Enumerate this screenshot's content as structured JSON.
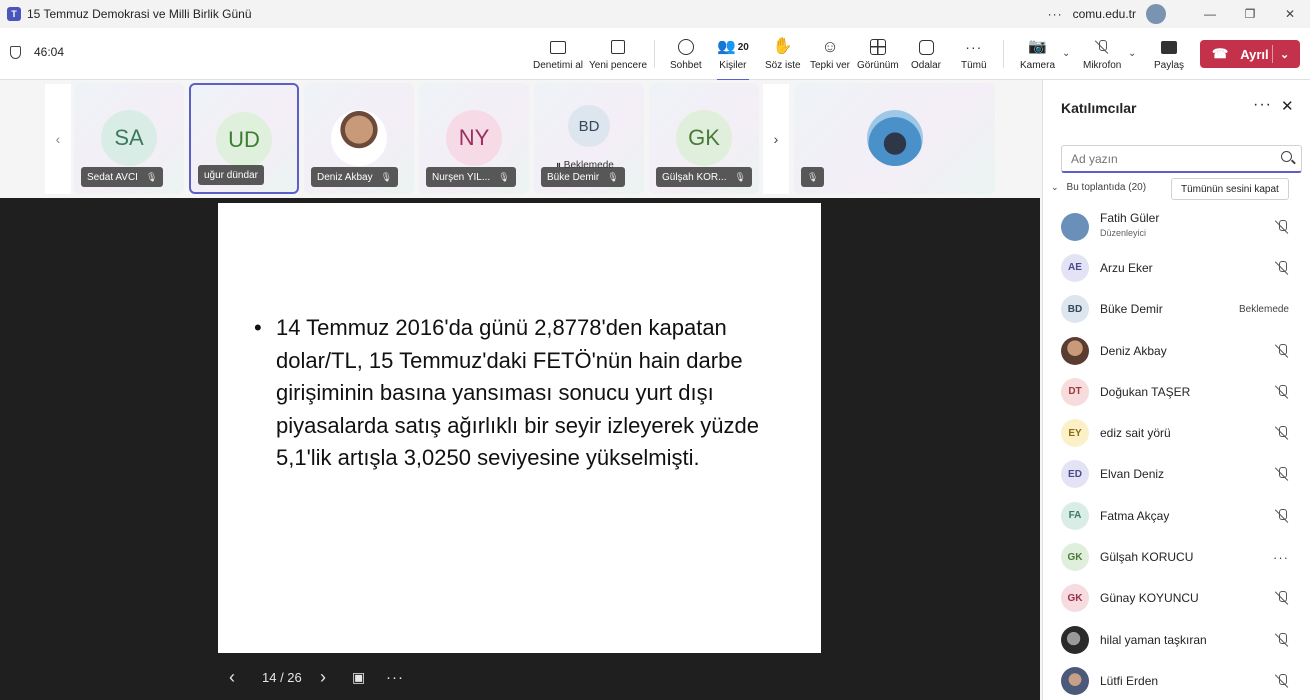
{
  "window": {
    "title": "15 Temmuz Demokrasi ve Milli Birlik Günü",
    "org": "comu.edu.tr",
    "app_icon": "teams-icon"
  },
  "toolbar": {
    "timer": "46:04",
    "buttons": [
      {
        "label": "Denetimi al",
        "icon": "take-control-icon"
      },
      {
        "label": "Yeni pencere",
        "icon": "pop-out-icon"
      },
      {
        "label": "Sohbet",
        "icon": "chat-icon"
      },
      {
        "label": "Kişiler",
        "icon": "people-icon",
        "count": "20"
      },
      {
        "label": "Söz iste",
        "icon": "raise-hand-icon"
      },
      {
        "label": "Tepki ver",
        "icon": "react-icon"
      },
      {
        "label": "Görünüm",
        "icon": "view-icon"
      },
      {
        "label": "Odalar",
        "icon": "rooms-icon"
      },
      {
        "label": "Tümü",
        "icon": "more-icon"
      },
      {
        "label": "Kamera",
        "icon": "camera-off-icon"
      },
      {
        "label": "Mikrofon",
        "icon": "mic-off-icon"
      },
      {
        "label": "Paylaş",
        "icon": "share-icon"
      }
    ],
    "leave_label": "Ayrıl",
    "leave_color": "#c4314b",
    "accent_color": "#5b5fc7"
  },
  "strip": {
    "tiles": [
      {
        "initials": "SA",
        "name": "Sedat AVCI",
        "bg": "#d9ede6",
        "fg": "#3c7a5e"
      },
      {
        "initials": "UD",
        "name": "uğur dündar",
        "bg": "#dff0dc",
        "fg": "#3f7d35",
        "selected": true
      },
      {
        "initials": "",
        "name": "Deniz Akbay",
        "photo": true
      },
      {
        "initials": "NY",
        "name": "Nurşen YIL...",
        "bg": "#f6dbe6",
        "fg": "#9b2f5e"
      },
      {
        "initials": "BD",
        "name": "Büke Demir",
        "bg": "#dde5ee",
        "fg": "#34495e",
        "status": "Beklemede"
      },
      {
        "initials": "GK",
        "name": "Gülşah KOR...",
        "bg": "#e0efdc",
        "fg": "#4a7a3a"
      },
      {
        "initials": "",
        "name": "",
        "photo2": true
      }
    ]
  },
  "slide": {
    "bullet": "14 Temmuz 2016'da günü 2,8778'den kapatan dolar/TL, 15 Temmuz'daki FETÖ'nün hain darbe girişiminin basına yansıması sonucu yurt dışı piyasalarda satış ağırlıklı bir seyir izleyerek yüzde 5,1'lik artışla 3,0250 seviyesine yükselmişti.",
    "page": "14 / 26"
  },
  "panel": {
    "title": "Katılımcılar",
    "search_placeholder": "Ad yazın",
    "section_label": "Bu toplantıda (20)",
    "mute_all": "Tümünün sesini kapat",
    "participants": [
      {
        "name": "Fatih Güler",
        "role": "Düzenleyici",
        "initials": "",
        "photo": true,
        "bg": "#6a8fb8",
        "state": "muted"
      },
      {
        "name": "Arzu Eker",
        "initials": "AE",
        "bg": "#e4e3f5",
        "fg": "#4b4a8c",
        "state": "muted"
      },
      {
        "name": "Büke Demir",
        "initials": "BD",
        "bg": "#dde5ee",
        "fg": "#34495e",
        "state": "hold",
        "status": "Beklemede"
      },
      {
        "name": "Deniz Akbay",
        "initials": "",
        "photo": true,
        "bg": "#b07a5e",
        "state": "muted"
      },
      {
        "name": "Doğukan TAŞER",
        "initials": "DT",
        "bg": "#f6dcdc",
        "fg": "#9c3a3a",
        "state": "muted"
      },
      {
        "name": "ediz sait yörü",
        "initials": "EY",
        "bg": "#fbf0c8",
        "fg": "#8a6d12",
        "state": "muted"
      },
      {
        "name": "Elvan Deniz",
        "initials": "ED",
        "bg": "#e4e3f5",
        "fg": "#4b4a8c",
        "state": "muted"
      },
      {
        "name": "Fatma Akçay",
        "initials": "FA",
        "bg": "#d9ede6",
        "fg": "#3c7a5e",
        "state": "muted"
      },
      {
        "name": "Gülşah KORUCU",
        "initials": "GK",
        "bg": "#e0efdc",
        "fg": "#4a7a3a",
        "state": "more"
      },
      {
        "name": "Günay KOYUNCU",
        "initials": "GK",
        "bg": "#f6dbe0",
        "fg": "#9b2f4a",
        "state": "muted"
      },
      {
        "name": "hilal yaman taşkıran",
        "initials": "",
        "photo": true,
        "bg": "#3a3a3a",
        "state": "muted"
      },
      {
        "name": "Lütfi Erden",
        "initials": "",
        "photo": true,
        "bg": "#5a6a85",
        "state": "muted"
      }
    ]
  }
}
